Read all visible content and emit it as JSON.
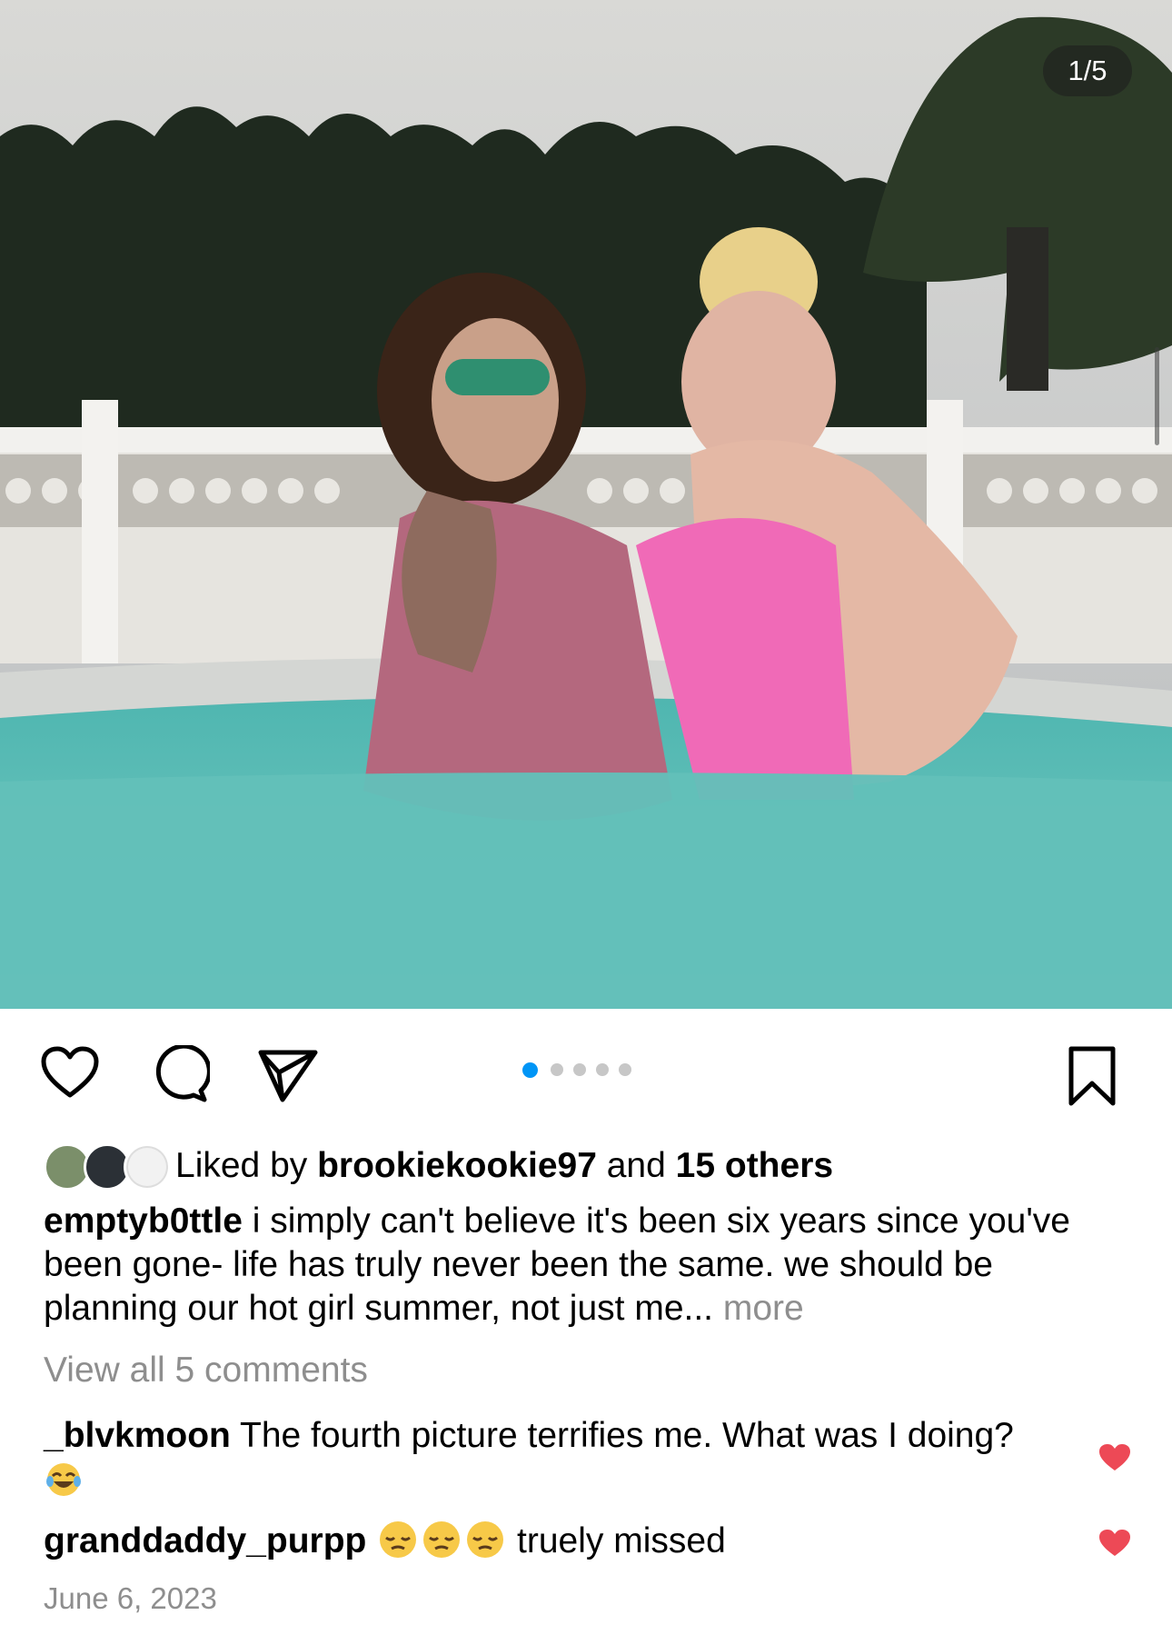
{
  "photo": {
    "counter": "1/5"
  },
  "carousel": {
    "total": 5,
    "active_index": 0
  },
  "colors": {
    "accent": "#0095f6",
    "muted": "#8e8e8e",
    "like_red": "#ed4956"
  },
  "actions": {
    "like_icon": "heart-icon",
    "comment_icon": "comment-icon",
    "share_icon": "send-icon",
    "save_icon": "bookmark-icon"
  },
  "likes": {
    "prefix": "Liked by ",
    "user": "brookiekookie97",
    "middle": " and ",
    "others": "15 others"
  },
  "caption": {
    "username": "emptyb0ttle",
    "text": " i simply can't believe it's been six years since you've been gone- life has truly never been the same. we should be planning our hot girl summer, not just me...",
    "more": " more"
  },
  "view_all": "View all 5 comments",
  "comments": [
    {
      "username": "_blvkmoon",
      "text": " The fourth picture terrifies me. What was I doing? ",
      "emoji": "face-with-tears-of-joy"
    },
    {
      "username": "granddaddy_purpp",
      "emoji": "pensive-face x3",
      "text": " truely missed"
    }
  ],
  "date": "June 6, 2023"
}
